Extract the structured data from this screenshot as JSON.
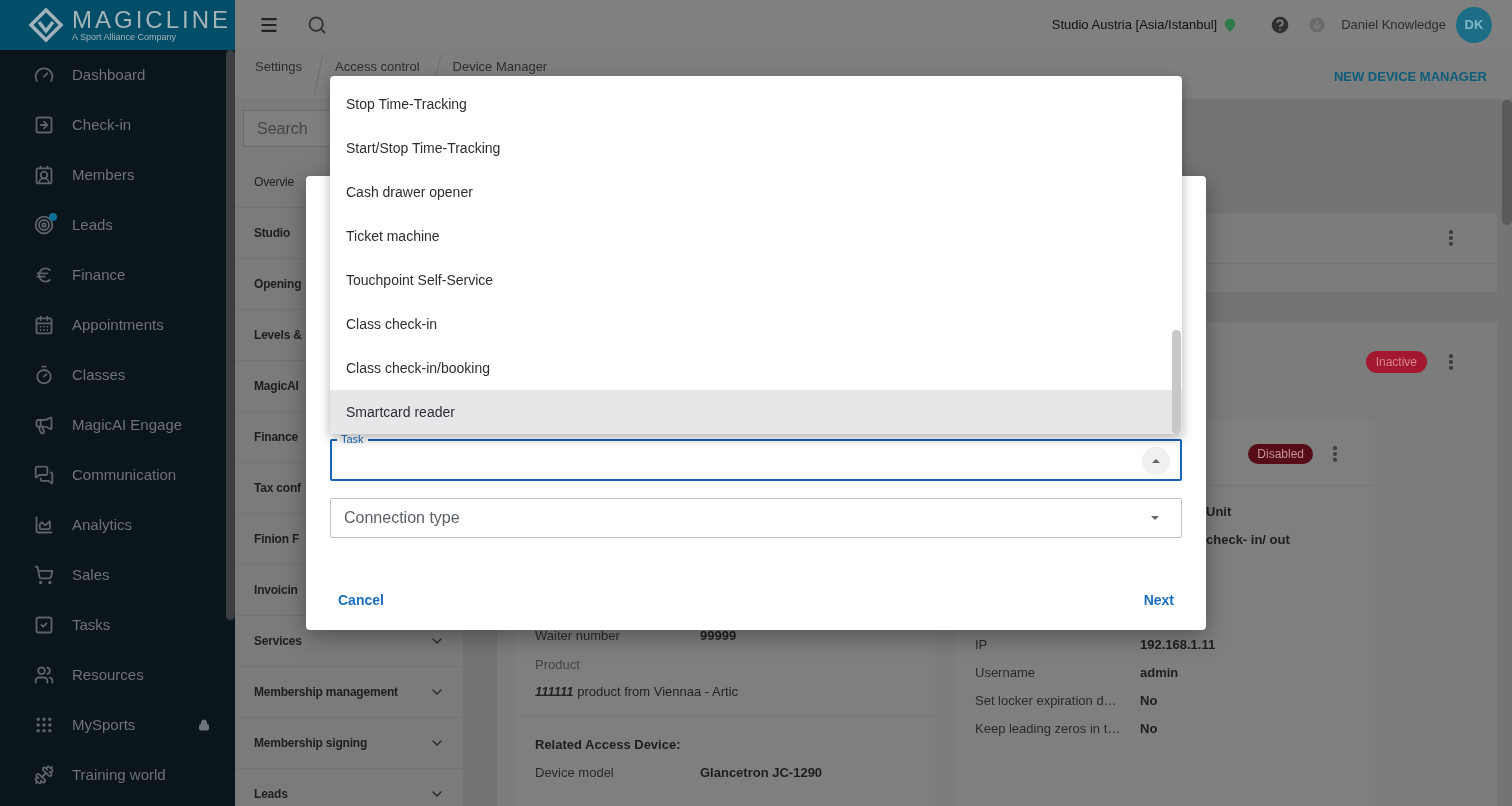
{
  "logo": {
    "name": "MAGICLINE",
    "tagline": "A Sport Alliance Company"
  },
  "sidebar": {
    "items": [
      {
        "label": "Dashboard",
        "badge_dot": false,
        "locked": false
      },
      {
        "label": "Check-in",
        "badge_dot": false,
        "locked": false
      },
      {
        "label": "Members",
        "badge_dot": false,
        "locked": false
      },
      {
        "label": "Leads",
        "badge_dot": true,
        "locked": false
      },
      {
        "label": "Finance",
        "badge_dot": false,
        "locked": false
      },
      {
        "label": "Appointments",
        "badge_dot": false,
        "locked": false
      },
      {
        "label": "Classes",
        "badge_dot": false,
        "locked": false
      },
      {
        "label": "MagicAI Engage",
        "badge_dot": false,
        "locked": false
      },
      {
        "label": "Communication",
        "badge_dot": false,
        "locked": false
      },
      {
        "label": "Analytics",
        "badge_dot": false,
        "locked": false
      },
      {
        "label": "Sales",
        "badge_dot": false,
        "locked": false
      },
      {
        "label": "Tasks",
        "badge_dot": false,
        "locked": false
      },
      {
        "label": "Resources",
        "badge_dot": false,
        "locked": false
      },
      {
        "label": "MySports",
        "badge_dot": false,
        "locked": true
      },
      {
        "label": "Training world",
        "badge_dot": false,
        "locked": false
      }
    ]
  },
  "topbar": {
    "studio": "Studio Austria [Asia/Istanbul]",
    "user_name": "Daniel Knowledge",
    "user_initials": "DK"
  },
  "breadcrumbs": [
    "Settings",
    "Access control",
    "Device Manager"
  ],
  "header_action": "NEW DEVICE MANAGER",
  "settings_menu": {
    "search_placeholder": "Search",
    "items": [
      {
        "label": "Overvie",
        "kind": "link"
      },
      {
        "label": "Studio",
        "kind": "section"
      },
      {
        "label": "Opening",
        "kind": "section"
      },
      {
        "label": "Levels &",
        "kind": "section"
      },
      {
        "label": "MagicAI",
        "kind": "section"
      },
      {
        "label": "Finance",
        "kind": "section"
      },
      {
        "label": "Tax conf",
        "kind": "section"
      },
      {
        "label": "Finion F",
        "kind": "section"
      },
      {
        "label": "Invoicin",
        "kind": "section"
      },
      {
        "label": "Services",
        "kind": "section",
        "expandable": true
      },
      {
        "label": "Membership management",
        "kind": "section",
        "expandable": true
      },
      {
        "label": "Membership signing",
        "kind": "section",
        "expandable": true
      },
      {
        "label": "Leads",
        "kind": "section",
        "expandable": true
      }
    ]
  },
  "cards": [
    {
      "status": "Inactive"
    }
  ],
  "left_device": {
    "rows": [
      {
        "label": "Waiter number",
        "value": "99999"
      }
    ],
    "product_label": "Product",
    "product": "**111111** product from Viennaa - Artic",
    "related_title": "Related Access Device:",
    "related_rows": [
      {
        "label": "Device model",
        "value": "Glancetron JC-1290"
      }
    ]
  },
  "right_device": {
    "status": "Disabled",
    "partial_values": [
      "Unit",
      "check- in/ out"
    ],
    "rows": [
      {
        "label": "IP",
        "value": "192.168.1.11"
      },
      {
        "label": "Username",
        "value": "admin"
      },
      {
        "label": "Set locker expiration d…",
        "value": "No"
      },
      {
        "label": "Keep leading zeros in t…",
        "value": "No"
      }
    ]
  },
  "dropdown": {
    "options": [
      {
        "label": "Stop Time-Tracking",
        "highlighted": false
      },
      {
        "label": "Start/Stop Time-Tracking",
        "highlighted": false
      },
      {
        "label": "Cash drawer opener",
        "highlighted": false
      },
      {
        "label": "Ticket machine",
        "highlighted": false
      },
      {
        "label": "Touchpoint Self-Service",
        "highlighted": false
      },
      {
        "label": "Class check-in",
        "highlighted": false
      },
      {
        "label": "Class check-in/booking",
        "highlighted": false
      },
      {
        "label": "Smartcard reader",
        "highlighted": true
      }
    ]
  },
  "dialog": {
    "fields": [
      {
        "label": "Task",
        "focused": true,
        "expanded": true
      },
      {
        "placeholder": "Connection type",
        "focused": false,
        "expanded": false
      }
    ],
    "cancel": "Cancel",
    "next": "Next"
  }
}
